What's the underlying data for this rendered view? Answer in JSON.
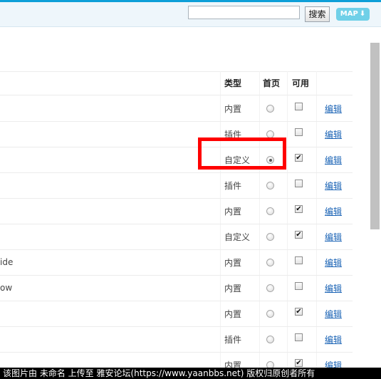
{
  "header": {
    "search_value": "",
    "search_button": "搜索",
    "map_button": "MAP",
    "map_arrow": "⬇"
  },
  "table": {
    "headers": {
      "type": "类型",
      "home": "首页",
      "enabled": "可用"
    },
    "rows": [
      {
        "name": "",
        "type": "内置",
        "home": false,
        "enabled": false,
        "action": "编辑"
      },
      {
        "name": "",
        "type": "插件",
        "home": false,
        "enabled": false,
        "action": "编辑"
      },
      {
        "name": "",
        "type": "自定义",
        "home": true,
        "enabled": true,
        "action": "编辑"
      },
      {
        "name": "",
        "type": "插件",
        "home": false,
        "enabled": false,
        "action": "编辑"
      },
      {
        "name": "",
        "type": "内置",
        "home": false,
        "enabled": true,
        "action": "编辑"
      },
      {
        "name": "",
        "type": "自定义",
        "home": false,
        "enabled": true,
        "action": "编辑"
      },
      {
        "name": "ide",
        "type": "内置",
        "home": false,
        "enabled": false,
        "action": "编辑"
      },
      {
        "name": "ow",
        "type": "内置",
        "home": false,
        "enabled": false,
        "action": "编辑"
      },
      {
        "name": "",
        "type": "内置",
        "home": false,
        "enabled": true,
        "action": "编辑"
      },
      {
        "name": "",
        "type": "插件",
        "home": false,
        "enabled": false,
        "action": "编辑"
      },
      {
        "name": "",
        "type": "内置",
        "home": false,
        "enabled": true,
        "action": "编辑"
      }
    ]
  },
  "highlight_color": "#ff0000",
  "footer": {
    "watermark": "该图片由 未命名 上传至 雅安论坛(https://www.yaanbbs.net) 版权归原创者所有"
  }
}
